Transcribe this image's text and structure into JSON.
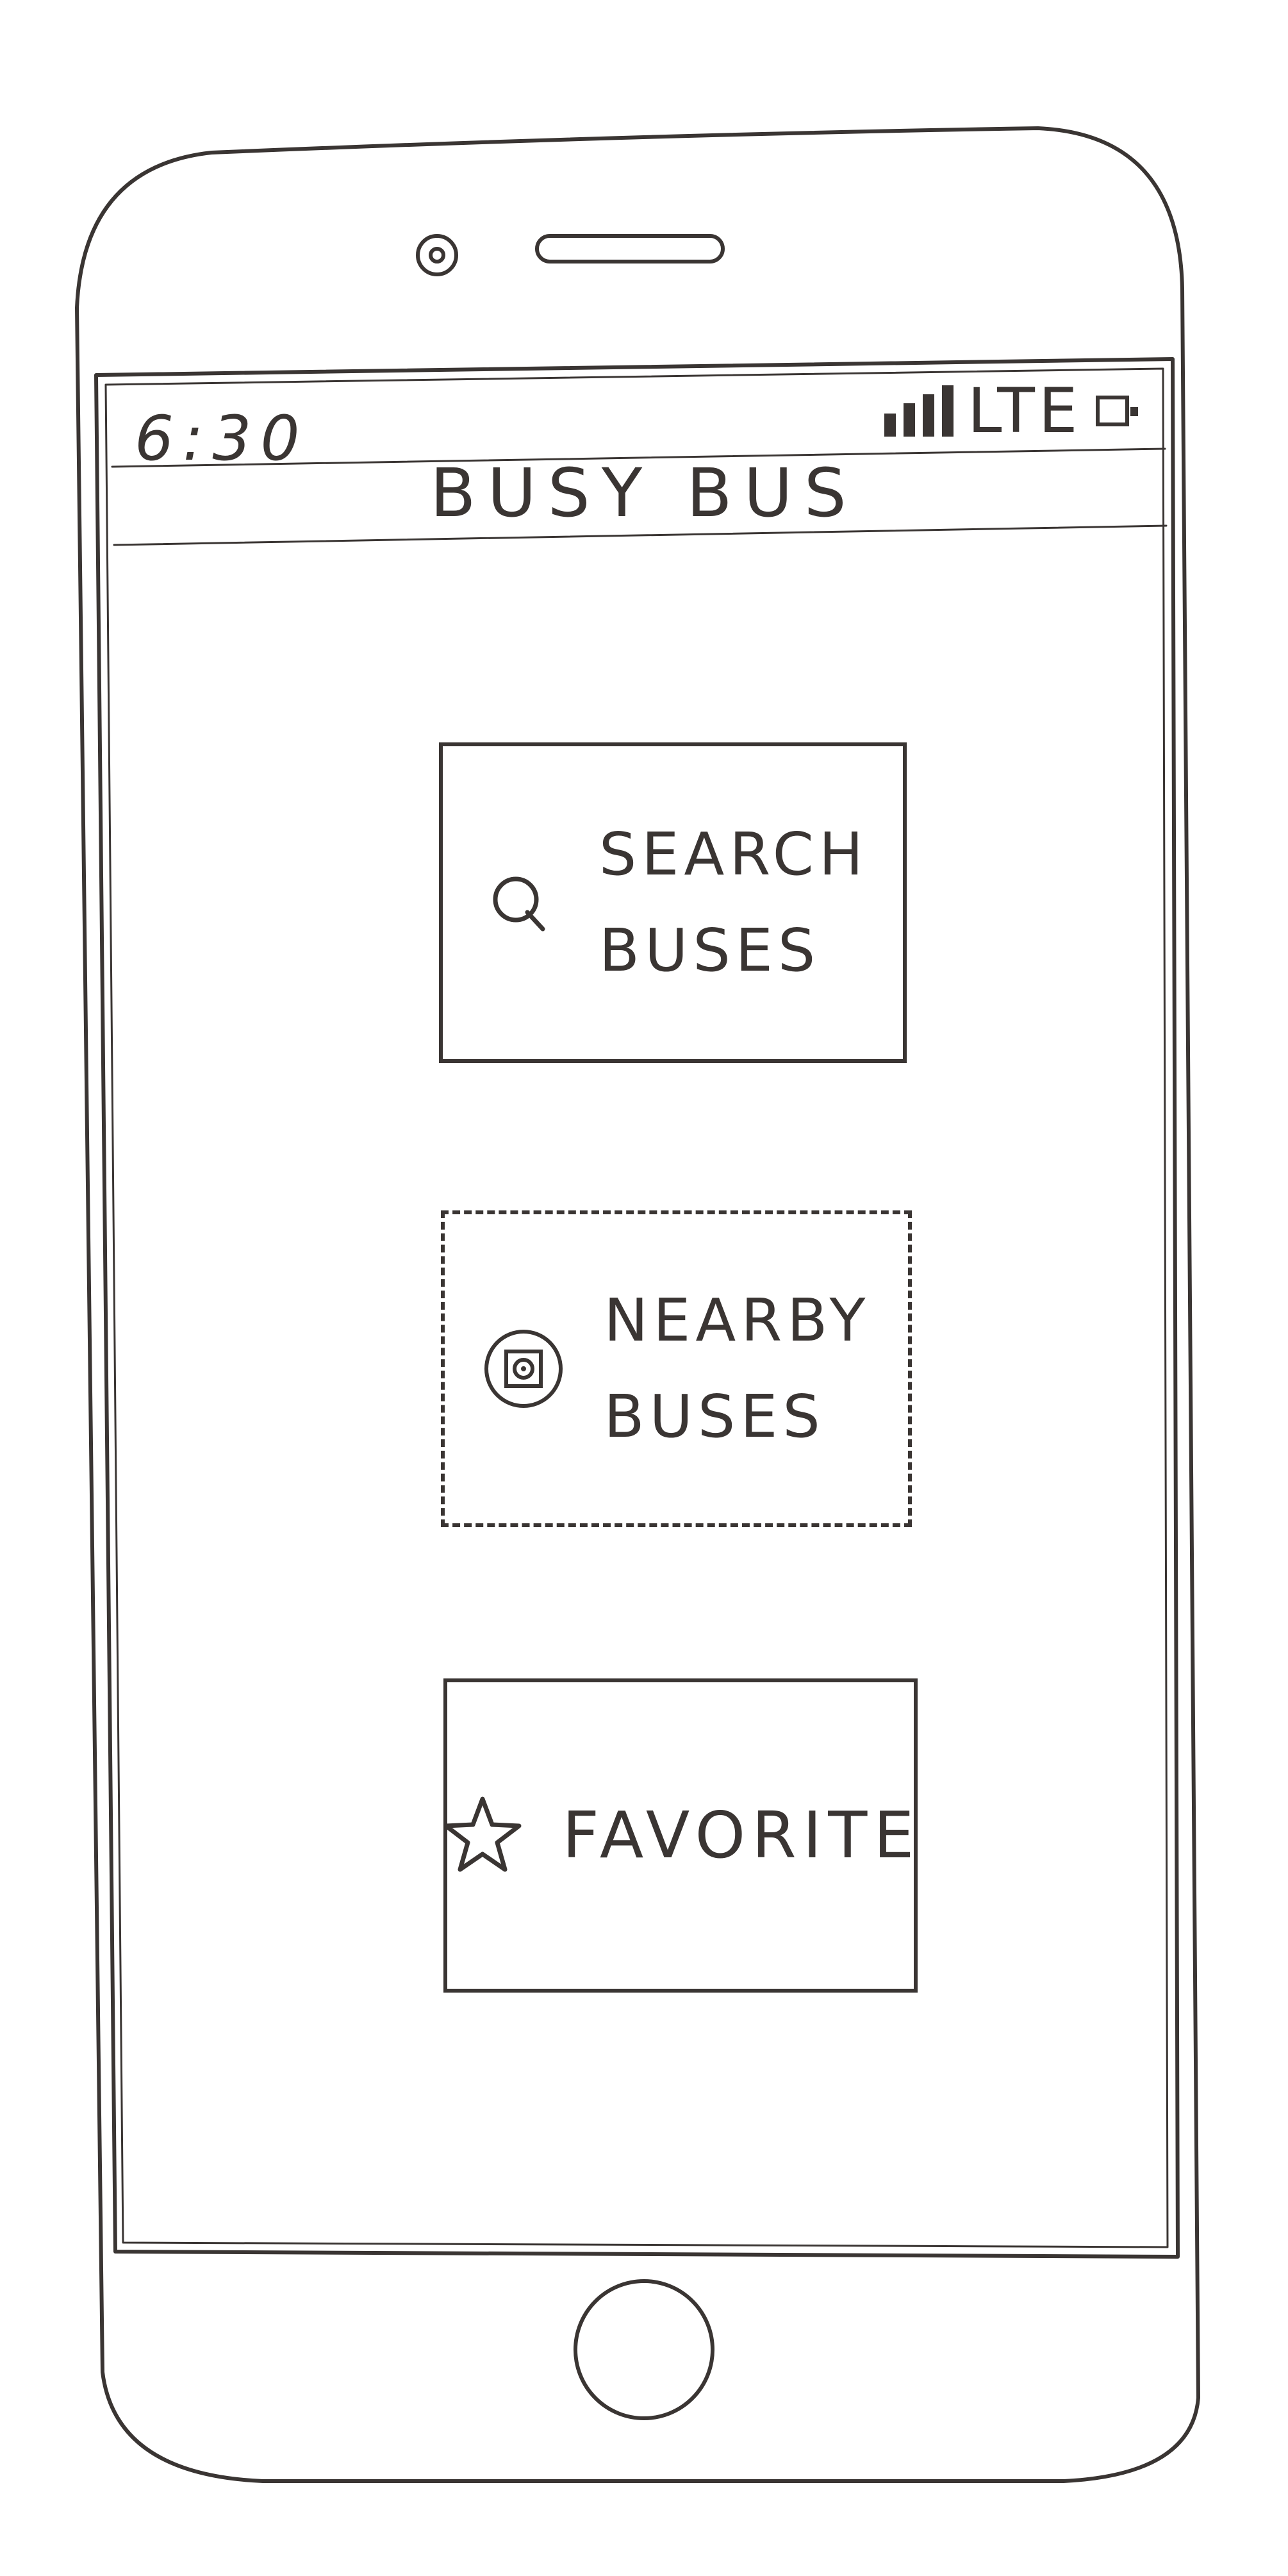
{
  "status_bar": {
    "time": "6:30",
    "network": "LTE",
    "icons": [
      "signal-bars-icon",
      "battery-icon"
    ]
  },
  "app": {
    "title": "BUSY BUS"
  },
  "menu": {
    "search": {
      "label": "SEARCH\nBUSES",
      "icon": "search-icon"
    },
    "nearby": {
      "label": "NEARBY\nBUSES",
      "icon": "location-target-icon"
    },
    "favorite": {
      "label": "FAVORITE",
      "icon": "star-icon"
    }
  },
  "colors": {
    "ink": "#3a3533",
    "paper": "#ffffff"
  }
}
